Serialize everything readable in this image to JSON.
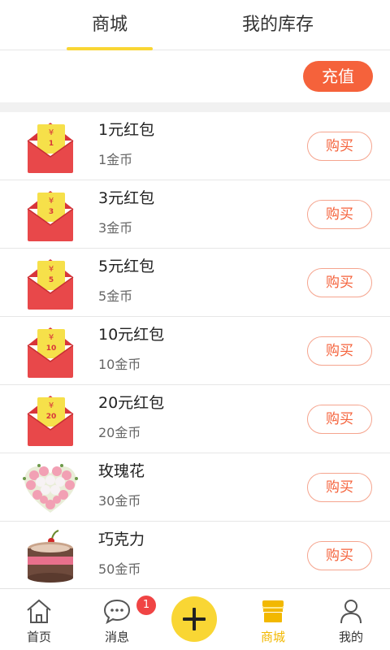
{
  "tabs": {
    "shop": "商城",
    "inventory": "我的库存",
    "active": "shop"
  },
  "recharge_label": "充值",
  "items": [
    {
      "name": "1元红包",
      "price": "1金币",
      "icon": "red-envelope-icon",
      "envelope_value": "1",
      "buy": "购买"
    },
    {
      "name": "3元红包",
      "price": "3金币",
      "icon": "red-envelope-icon",
      "envelope_value": "3",
      "buy": "购买"
    },
    {
      "name": "5元红包",
      "price": "5金币",
      "icon": "red-envelope-icon",
      "envelope_value": "5",
      "buy": "购买"
    },
    {
      "name": "10元红包",
      "price": "10金币",
      "icon": "red-envelope-icon",
      "envelope_value": "10",
      "buy": "购买"
    },
    {
      "name": "20元红包",
      "price": "20金币",
      "icon": "red-envelope-icon",
      "envelope_value": "20",
      "buy": "购买"
    },
    {
      "name": "玫瑰花",
      "price": "30金币",
      "icon": "rose-heart-icon",
      "buy": "购买"
    },
    {
      "name": "巧克力",
      "price": "50金币",
      "icon": "chocolate-cake-icon",
      "buy": "购买"
    }
  ],
  "nav": {
    "home": "首页",
    "messages": "消息",
    "messages_badge": "1",
    "shop": "商城",
    "mine": "我的"
  },
  "colors": {
    "accent_yellow": "#f9d634",
    "accent_orange": "#f5623b",
    "active_nav": "#f2b800",
    "badge_red": "#f04444"
  }
}
